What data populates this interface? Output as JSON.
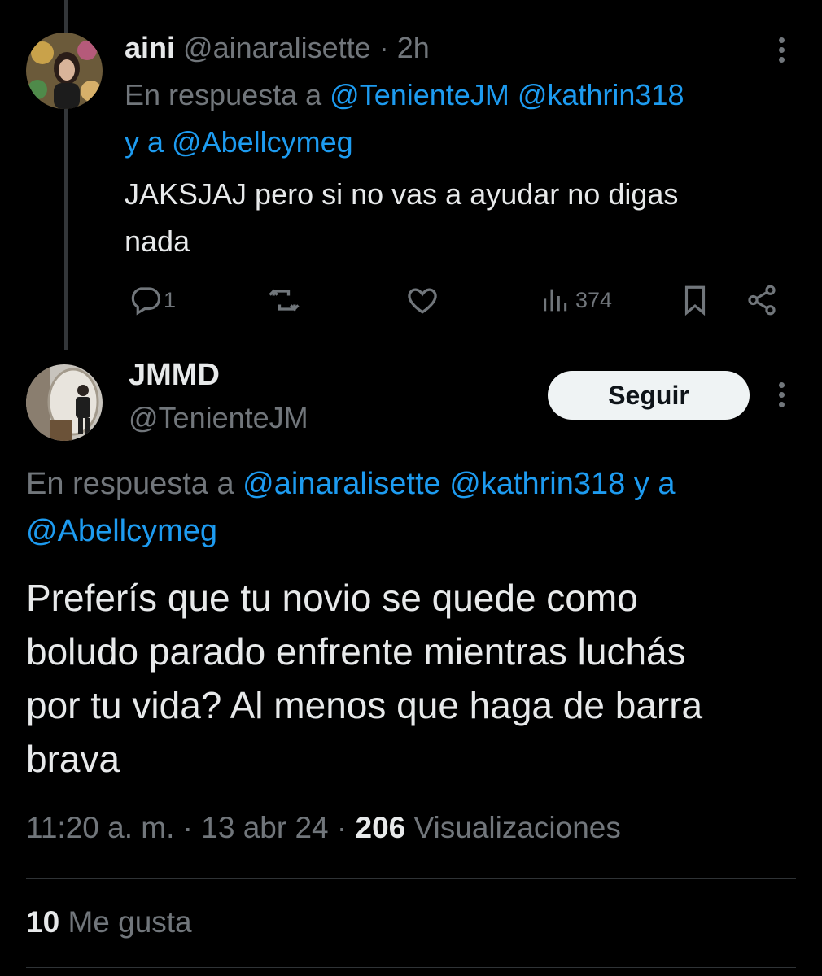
{
  "reply_tweet": {
    "display_name": "aini",
    "handle": "@ainaralisette",
    "separator": "·",
    "time": "2h",
    "replying_prefix": "En respuesta a",
    "replying_mentions": [
      "@TenienteJM",
      "@kathrin318"
    ],
    "replying_join": "y a",
    "replying_last": "@Abellcymeg",
    "text_line1": "JAKSJAJ pero si no vas a ayudar no digas",
    "text_line2": "nada",
    "actions": {
      "reply_count": "1",
      "views_count": "374"
    }
  },
  "main_tweet": {
    "display_name": "JMMD",
    "handle": "@TenienteJM",
    "follow_label": "Seguir",
    "replying_prefix": "En respuesta a",
    "replying_mentions": [
      "@ainaralisette",
      "@kathrin318"
    ],
    "replying_join": "y a",
    "replying_last": "@Abellcymeg",
    "text_lines": [
      "Preferís que tu novio se quede como",
      "boludo parado enfrente mientras luchás",
      "por tu vida? Al menos que haga de barra",
      "brava"
    ],
    "time": "11:20 a. m.",
    "date": "13 abr 24",
    "views_count": "206",
    "views_label": "Visualizaciones",
    "likes_count": "10",
    "likes_label": "Me gusta"
  },
  "icons": [
    "more-icon",
    "reply-icon",
    "retweet-icon",
    "like-icon",
    "views-icon",
    "bookmark-icon",
    "share-icon"
  ],
  "colors": {
    "background": "#000000",
    "text": "#e7e9ea",
    "muted": "#71767b",
    "link": "#1d9bf0",
    "follow_button": "#eff3f4"
  }
}
